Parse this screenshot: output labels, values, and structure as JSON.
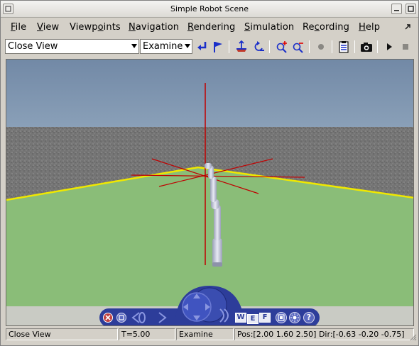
{
  "window": {
    "title": "Simple Robot Scene"
  },
  "menubar": {
    "items": [
      {
        "label_u": "F",
        "label_rest": "ile"
      },
      {
        "label_u": "V",
        "label_rest": "iew"
      },
      {
        "label_pre": "Viewp",
        "label_u": "o",
        "label_rest": "ints"
      },
      {
        "label_u": "N",
        "label_rest": "avigation"
      },
      {
        "label_u": "R",
        "label_rest": "endering"
      },
      {
        "label_u": "S",
        "label_rest": "imulation"
      },
      {
        "label_pre": "Re",
        "label_u": "c",
        "label_rest": "ording"
      },
      {
        "label_u": "H",
        "label_rest": "elp"
      }
    ]
  },
  "toolbar": {
    "viewpoint_value": "Close View",
    "mode_value": "Examine"
  },
  "nav": {
    "button_w": "W",
    "button_e": "E",
    "button_f": "F",
    "button_help": "?"
  },
  "status": {
    "viewpoint": "Close View",
    "time": "T=5.00",
    "mode": "Examine",
    "position": "Pos:[2.00 1.60 2.50] Dir:[-0.63 -0.20 -0.75]"
  },
  "colors": {
    "sky": "#7d93ad",
    "ground": "#8abd78",
    "wall": "#777777",
    "axis": "#c00000",
    "boundary": "#f0e800",
    "nav_blue": "#2d3d9a"
  }
}
